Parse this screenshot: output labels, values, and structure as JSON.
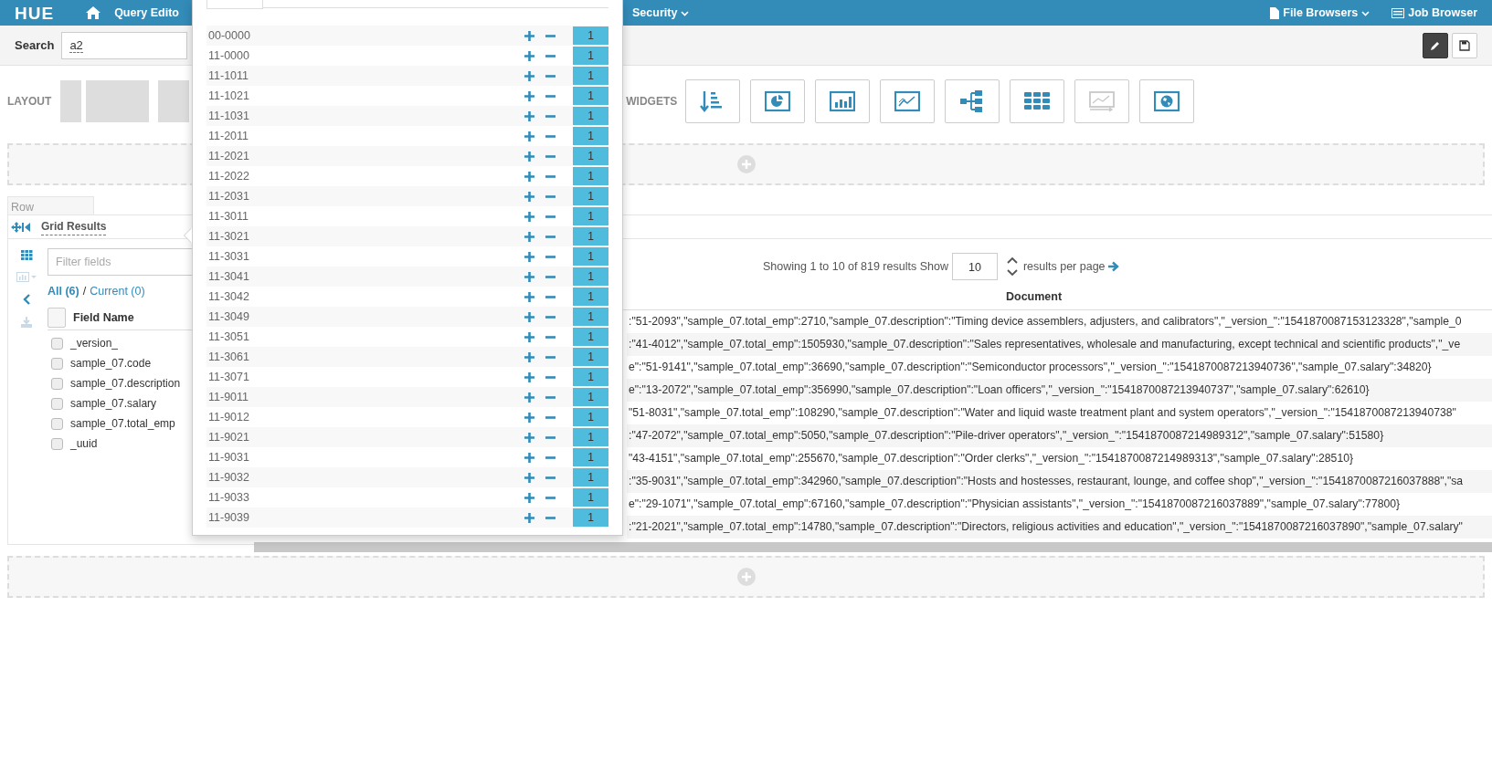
{
  "navbar": {
    "logo": "HUE",
    "left_items": [
      {
        "label": "Query Edito",
        "kind": "link"
      },
      {
        "label": "Security",
        "kind": "dropdown"
      }
    ],
    "right_items": [
      {
        "label": "File Browsers",
        "kind": "dropdown"
      },
      {
        "label": "Job Browser",
        "kind": "link"
      }
    ]
  },
  "toolbar": {
    "search_label": "Search",
    "search_value": "a2"
  },
  "layout": {
    "label": "LAYOUT",
    "widgets_label": "WIDGETS",
    "widgets": [
      {
        "kind": "facet",
        "disabled": false
      },
      {
        "kind": "pie",
        "disabled": false
      },
      {
        "kind": "bar",
        "disabled": false
      },
      {
        "kind": "line",
        "disabled": false
      },
      {
        "kind": "tree",
        "disabled": false
      },
      {
        "kind": "grid",
        "disabled": false
      },
      {
        "kind": "timeline",
        "disabled": true
      },
      {
        "kind": "map",
        "disabled": false
      }
    ]
  },
  "row_label": "Row",
  "grid_widget": {
    "title": "Grid Results",
    "tools": [
      {
        "kind": "grid",
        "disabled": false
      },
      {
        "kind": "chart",
        "disabled": true
      },
      {
        "kind": "collapse",
        "disabled": false
      },
      {
        "kind": "download",
        "disabled": true
      }
    ],
    "filter_placeholder": "Filter fields",
    "all_label": "All (6)",
    "separator": "/",
    "current_label": "Current (0)",
    "column_header": "Field Name",
    "select_all_checked": false,
    "fields": [
      {
        "name": "_version_",
        "checked": false
      },
      {
        "name": "sample_07.code",
        "checked": false
      },
      {
        "name": "sample_07.description",
        "checked": false
      },
      {
        "name": "sample_07.salary",
        "checked": false
      },
      {
        "name": "sample_07.total_emp",
        "checked": false
      },
      {
        "name": "_uuid",
        "checked": false
      }
    ],
    "pagination": {
      "showing": "Showing 1 to 10 of 819 results Show",
      "page_size": "10",
      "suffix": "results per page"
    },
    "document_header": "Document",
    "rows": [
      ":\"51-2093\",\"sample_07.total_emp\":2710,\"sample_07.description\":\"Timing device assemblers, adjusters, and calibrators\",\"_version_\":\"1541870087153123328\",\"sample_0",
      ":\"41-4012\",\"sample_07.total_emp\":1505930,\"sample_07.description\":\"Sales representatives, wholesale and manufacturing, except technical and scientific products\",\"_ve",
      "e\":\"51-9141\",\"sample_07.total_emp\":36690,\"sample_07.description\":\"Semiconductor processors\",\"_version_\":\"1541870087213940736\",\"sample_07.salary\":34820}",
      "e\":\"13-2072\",\"sample_07.total_emp\":356990,\"sample_07.description\":\"Loan officers\",\"_version_\":\"1541870087213940737\",\"sample_07.salary\":62610}",
      "\"51-8031\",\"sample_07.total_emp\":108290,\"sample_07.description\":\"Water and liquid waste treatment plant and system operators\",\"_version_\":\"1541870087213940738\"",
      ":\"47-2072\",\"sample_07.total_emp\":5050,\"sample_07.description\":\"Pile-driver operators\",\"_version_\":\"1541870087214989312\",\"sample_07.salary\":51580}",
      "\"43-4151\",\"sample_07.total_emp\":255670,\"sample_07.description\":\"Order clerks\",\"_version_\":\"1541870087214989313\",\"sample_07.salary\":28510}",
      ":\"35-9031\",\"sample_07.total_emp\":342960,\"sample_07.description\":\"Hosts and hostesses, restaurant, lounge, and coffee shop\",\"_version_\":\"1541870087216037888\",\"sa",
      "e\":\"29-1071\",\"sample_07.total_emp\":67160,\"sample_07.description\":\"Physician assistants\",\"_version_\":\"1541870087216037889\",\"sample_07.salary\":77800}",
      ":\"21-2021\",\"sample_07.total_emp\":14780,\"sample_07.description\":\"Directors, religious activities and education\",\"_version_\":\"1541870087216037890\",\"sample_07.salary\""
    ]
  },
  "facet_popover": {
    "items": [
      {
        "value": "00-0000",
        "count": "1"
      },
      {
        "value": "11-0000",
        "count": "1"
      },
      {
        "value": "11-1011",
        "count": "1"
      },
      {
        "value": "11-1021",
        "count": "1"
      },
      {
        "value": "11-1031",
        "count": "1"
      },
      {
        "value": "11-2011",
        "count": "1"
      },
      {
        "value": "11-2021",
        "count": "1"
      },
      {
        "value": "11-2022",
        "count": "1"
      },
      {
        "value": "11-2031",
        "count": "1"
      },
      {
        "value": "11-3011",
        "count": "1"
      },
      {
        "value": "11-3021",
        "count": "1"
      },
      {
        "value": "11-3031",
        "count": "1"
      },
      {
        "value": "11-3041",
        "count": "1"
      },
      {
        "value": "11-3042",
        "count": "1"
      },
      {
        "value": "11-3049",
        "count": "1"
      },
      {
        "value": "11-3051",
        "count": "1"
      },
      {
        "value": "11-3061",
        "count": "1"
      },
      {
        "value": "11-3071",
        "count": "1"
      },
      {
        "value": "11-9011",
        "count": "1"
      },
      {
        "value": "11-9012",
        "count": "1"
      },
      {
        "value": "11-9021",
        "count": "1"
      },
      {
        "value": "11-9031",
        "count": "1"
      },
      {
        "value": "11-9032",
        "count": "1"
      },
      {
        "value": "11-9033",
        "count": "1"
      },
      {
        "value": "11-9039",
        "count": "1"
      }
    ]
  }
}
